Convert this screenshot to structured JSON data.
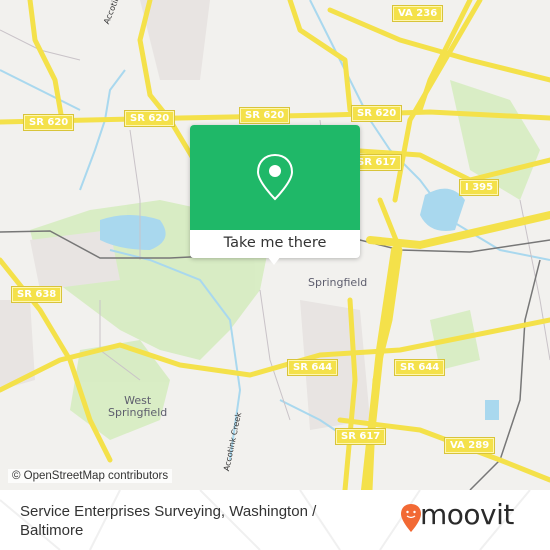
{
  "map": {
    "attribution": "© OpenStreetMap contributors",
    "road_shields": [
      {
        "label": "SR 620",
        "id": "sr620-west"
      },
      {
        "label": "SR 620",
        "id": "sr620-center"
      },
      {
        "label": "SR 620",
        "id": "sr620-mid"
      },
      {
        "label": "SR 620",
        "id": "sr620-east"
      },
      {
        "label": "VA 236",
        "id": "va236"
      },
      {
        "label": "SR 617",
        "id": "sr617-north"
      },
      {
        "label": "I 395",
        "id": "i395"
      },
      {
        "label": "SR 638",
        "id": "sr638"
      },
      {
        "label": "SR 644",
        "id": "sr644-west"
      },
      {
        "label": "SR 644",
        "id": "sr644-east"
      },
      {
        "label": "SR 617",
        "id": "sr617-south"
      },
      {
        "label": "VA 289",
        "id": "va289"
      }
    ],
    "places": [
      {
        "label": "Springfield"
      },
      {
        "label": "West\nSpringfield"
      }
    ],
    "water_labels": [
      {
        "label": "Accotink Creek"
      },
      {
        "label": "Accotink Creek"
      }
    ],
    "colors": {
      "background": "#f2f1ee",
      "road": "#f4e14a",
      "water": "#a9d8ee",
      "park": "#d6ecc0"
    }
  },
  "popup": {
    "icon": "map-pin-icon",
    "button_label": "Take me there",
    "color": "#1fb868"
  },
  "footer": {
    "title": "Service Enterprises Surveying, Washington / Baltimore",
    "logo_text": "moovit",
    "logo_color": "#f26934"
  }
}
